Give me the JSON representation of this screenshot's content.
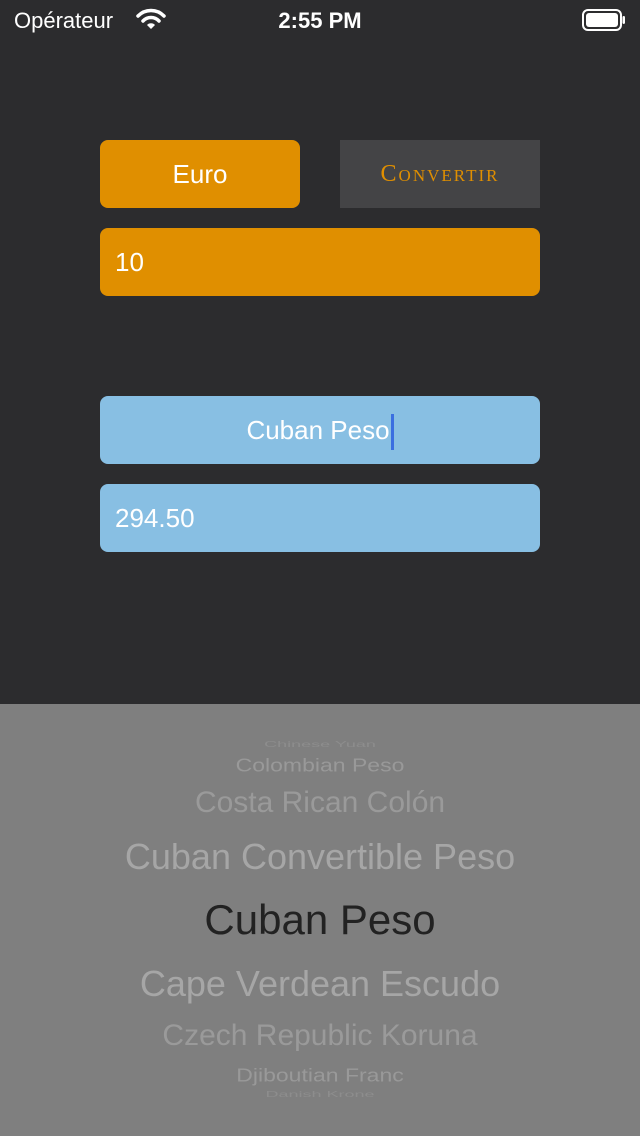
{
  "status_bar": {
    "carrier": "Opérateur",
    "time": "2:55 PM",
    "icons": [
      "wifi-icon",
      "battery-icon"
    ]
  },
  "converter": {
    "from_currency": "Euro",
    "convert_label": "Convertir",
    "amount_value": "10",
    "to_currency": "Cuban Peso",
    "result_value": "294.50"
  },
  "picker": {
    "items": [
      "Chinese Yuan",
      "Colombian Peso",
      "Costa Rican Colón",
      "Cuban Convertible Peso",
      "Cuban Peso",
      "Cape Verdean Escudo",
      "Czech Republic Koruna",
      "Djiboutian Franc",
      "Danish Krone"
    ],
    "selected": "Cuban Peso"
  },
  "colors": {
    "background": "#2c2c2e",
    "orange_accent": "#e08f00",
    "blue_accent": "#88bfe3",
    "convert_button_bg": "#444446",
    "picker_bg": "#7f7f7f",
    "caret": "#3b6fe0"
  }
}
